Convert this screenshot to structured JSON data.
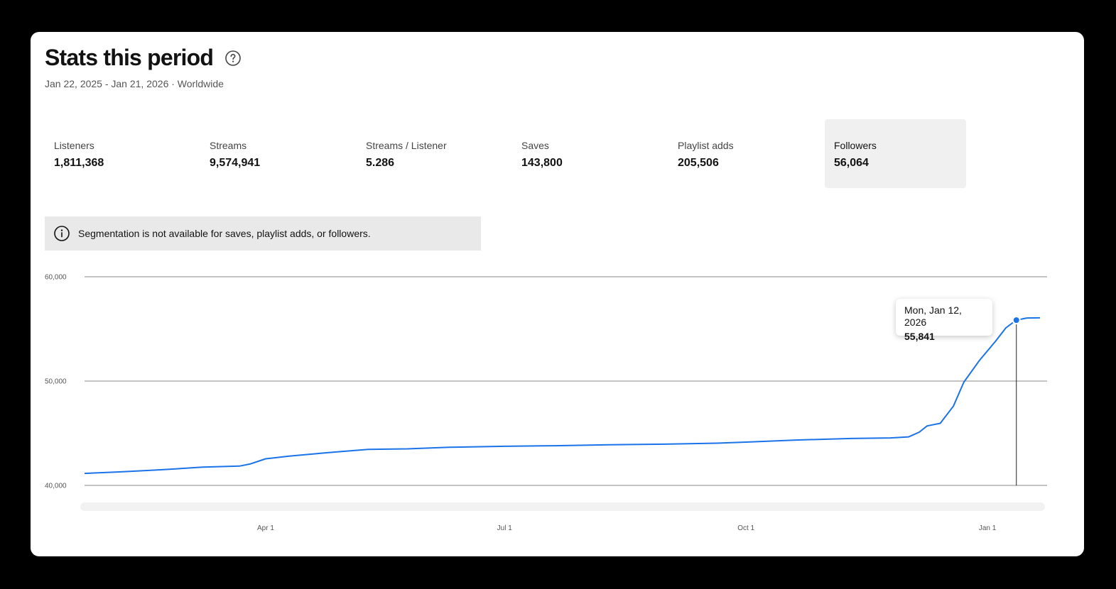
{
  "header": {
    "title": "Stats this period",
    "subtitle": "Jan 22, 2025 - Jan 21, 2026 · Worldwide"
  },
  "metrics": [
    {
      "label": "Listeners",
      "value": "1,811,368"
    },
    {
      "label": "Streams",
      "value": "9,574,941"
    },
    {
      "label": "Streams / Listener",
      "value": "5.286"
    },
    {
      "label": "Saves",
      "value": "143,800"
    },
    {
      "label": "Playlist adds",
      "value": "205,506"
    },
    {
      "label": "Followers",
      "value": "56,064",
      "selected": true
    }
  ],
  "notice": {
    "text": "Segmentation is not available for saves, playlist adds, or followers."
  },
  "tooltip": {
    "date": "Mon, Jan 12, 2026",
    "value": "55,841"
  },
  "colors": {
    "line": "#1a73e8",
    "selected_bg": "#f0f0f0"
  },
  "chart_data": {
    "type": "line",
    "ylim": [
      40000,
      60000
    ],
    "y_ticks": [
      {
        "value": 60000,
        "label": "60,000"
      },
      {
        "value": 50000,
        "label": "50,000"
      },
      {
        "value": 40000,
        "label": "40,000"
      }
    ],
    "x_ticks": [
      {
        "date": "2025-04-01",
        "label": "Apr 1"
      },
      {
        "date": "2025-07-01",
        "label": "Jul 1"
      },
      {
        "date": "2025-10-01",
        "label": "Oct 1"
      },
      {
        "date": "2026-01-01",
        "label": "Jan 1"
      }
    ],
    "xlim": [
      "2025-01-22",
      "2026-01-21"
    ],
    "series": [
      {
        "points": [
          [
            "2025-01-22",
            41150
          ],
          [
            "2025-02-05",
            41300
          ],
          [
            "2025-02-20",
            41500
          ],
          [
            "2025-03-08",
            41750
          ],
          [
            "2025-03-22",
            41850
          ],
          [
            "2025-03-26",
            42050
          ],
          [
            "2025-04-01",
            42550
          ],
          [
            "2025-04-10",
            42800
          ],
          [
            "2025-04-25",
            43150
          ],
          [
            "2025-05-10",
            43450
          ],
          [
            "2025-05-25",
            43500
          ],
          [
            "2025-06-10",
            43650
          ],
          [
            "2025-07-01",
            43750
          ],
          [
            "2025-07-20",
            43800
          ],
          [
            "2025-08-10",
            43900
          ],
          [
            "2025-08-31",
            43950
          ],
          [
            "2025-09-20",
            44050
          ],
          [
            "2025-10-01",
            44150
          ],
          [
            "2025-10-20",
            44350
          ],
          [
            "2025-11-10",
            44500
          ],
          [
            "2025-11-25",
            44550
          ],
          [
            "2025-12-02",
            44650
          ],
          [
            "2025-12-06",
            45100
          ],
          [
            "2025-12-09",
            45700
          ],
          [
            "2025-12-14",
            45950
          ],
          [
            "2025-12-19",
            47600
          ],
          [
            "2025-12-23",
            49900
          ],
          [
            "2025-12-29",
            52000
          ],
          [
            "2026-01-04",
            53800
          ],
          [
            "2026-01-08",
            55100
          ],
          [
            "2026-01-12",
            55841
          ],
          [
            "2026-01-16",
            56050
          ],
          [
            "2026-01-21",
            56064
          ]
        ]
      }
    ],
    "highlight": {
      "date": "2026-01-12",
      "value": 55841
    }
  }
}
